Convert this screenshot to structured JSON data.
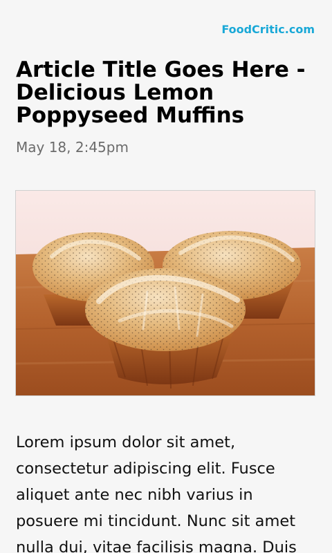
{
  "header": {
    "brand": "FoodCritic.com"
  },
  "article": {
    "title": "Article Title Goes Here - Delicious Lemon Poppyseed Muffins",
    "date": "May 18, 2:45pm",
    "body": "Lorem ipsum dolor sit amet, consectetur adipiscing elit. Fusce aliquet ante nec nibh varius in posuere mi tincidunt. Nunc sit amet nulla dui, vitae facilisis magna. Duis"
  },
  "colors": {
    "brand": "#19a8d7",
    "background": "#f6f6f6",
    "date": "#6b6b6b"
  }
}
